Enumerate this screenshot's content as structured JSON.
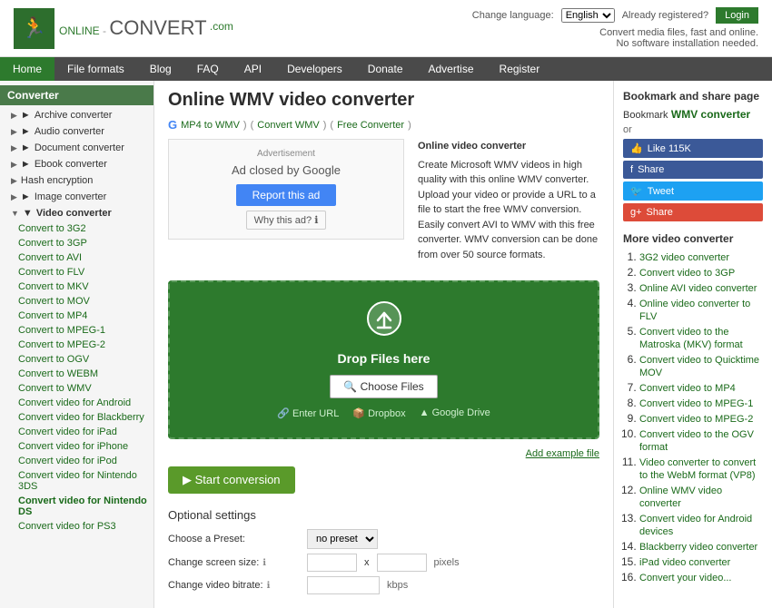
{
  "header": {
    "logo_online": "ONLINE",
    "logo_convert": "CONVERT",
    "logo_com": ".com",
    "change_language": "Change language:",
    "language": "English",
    "already_registered": "Already registered?",
    "login_label": "Login",
    "tagline_line1": "Convert media files, fast and online.",
    "tagline_line2": "No software installation needed."
  },
  "nav": {
    "items": [
      {
        "label": "Home",
        "active": true
      },
      {
        "label": "File formats"
      },
      {
        "label": "Blog"
      },
      {
        "label": "FAQ"
      },
      {
        "label": "API"
      },
      {
        "label": "Developers"
      },
      {
        "label": "Donate"
      },
      {
        "label": "Advertise"
      },
      {
        "label": "Register"
      }
    ]
  },
  "sidebar": {
    "title": "Converter",
    "items": [
      {
        "label": "Archive converter",
        "indent": false
      },
      {
        "label": "Audio converter",
        "indent": false
      },
      {
        "label": "Document converter",
        "indent": false
      },
      {
        "label": "Ebook converter",
        "indent": false
      },
      {
        "label": "Hash encryption",
        "indent": false
      },
      {
        "label": "Image converter",
        "indent": false
      },
      {
        "label": "Video converter",
        "indent": false,
        "open": true
      },
      {
        "label": "Convert to 3G2",
        "sub": true
      },
      {
        "label": "Convert to 3GP",
        "sub": true
      },
      {
        "label": "Convert to AVI",
        "sub": true
      },
      {
        "label": "Convert to FLV",
        "sub": true
      },
      {
        "label": "Convert to MKV",
        "sub": true
      },
      {
        "label": "Convert to MOV",
        "sub": true
      },
      {
        "label": "Convert to MP4",
        "sub": true
      },
      {
        "label": "Convert to MPEG-1",
        "sub": true
      },
      {
        "label": "Convert to MPEG-2",
        "sub": true
      },
      {
        "label": "Convert to OGV",
        "sub": true
      },
      {
        "label": "Convert to WEBM",
        "sub": true
      },
      {
        "label": "Convert to WMV",
        "sub": true
      },
      {
        "label": "Convert video for Android",
        "sub": true
      },
      {
        "label": "Convert video for Blackberry",
        "sub": true
      },
      {
        "label": "Convert video for iPad",
        "sub": true
      },
      {
        "label": "Convert video for iPhone",
        "sub": true
      },
      {
        "label": "Convert video for iPod",
        "sub": true
      },
      {
        "label": "Convert video for Nintendo 3DS",
        "sub": true
      },
      {
        "label": "Convert video for Nintendo DS",
        "sub": true
      },
      {
        "label": "Convert video for PS3",
        "sub": true
      }
    ]
  },
  "main": {
    "page_title": "Online WMV video converter",
    "breadcrumb": {
      "google": "Google",
      "mp4_to_wmv": "MP4 to WMV",
      "convert_wmv": "Convert WMV",
      "free_converter": "Free Converter"
    },
    "ad": {
      "label": "Advertisement",
      "closed_text": "Ad closed by Google",
      "report_label": "Report this ad",
      "why_label": "Why this ad? ℹ"
    },
    "description": {
      "title": "Online video converter",
      "text": "Create Microsoft WMV videos in high quality with this online WMV converter. Upload your video or provide a URL to a file to start the free WMV conversion. Easily convert AVI to WMV with this free converter. WMV conversion can be done from over 50 source formats."
    },
    "upload": {
      "drop_text": "Drop Files here",
      "choose_label": "Choose Files",
      "enter_url": "Enter URL",
      "dropbox": "Dropbox",
      "google_drive": "Google Drive",
      "add_example": "Add example file"
    },
    "start_btn": "Start conversion",
    "optional_title": "Optional settings",
    "settings": {
      "preset_label": "Choose a Preset:",
      "preset_value": "no preset",
      "screen_label": "Change screen size:",
      "screen_x": "x",
      "screen_unit": "pixels",
      "bitrate_label": "Change video bitrate:",
      "bitrate_unit": "kbps"
    }
  },
  "right_sidebar": {
    "title": "Bookmark and share page",
    "bookmark_label": "Bookmark",
    "link_label": "WMV converter",
    "or_label": "or",
    "social": [
      {
        "label": "Like 115K",
        "type": "facebook"
      },
      {
        "label": "Share",
        "type": "facebook2"
      },
      {
        "label": "Tweet",
        "type": "twitter"
      },
      {
        "label": "Share",
        "type": "gplus"
      }
    ],
    "more_title": "More video converter",
    "more_items": [
      "3G2 video converter",
      "Convert video to 3GP",
      "Online AVI video converter",
      "Online video converter to FLV",
      "Convert video to the Matroska (MKV) format",
      "Convert video to Quicktime MOV",
      "Convert video to MP4",
      "Convert video to MPEG-1",
      "Convert video to MPEG-2",
      "Convert video to the OGV format",
      "Video converter to convert to the WebM format (VP8)",
      "Online WMV video converter",
      "Convert video for Android devices",
      "Blackberry video converter",
      "iPad video converter",
      "Convert your video..."
    ]
  }
}
